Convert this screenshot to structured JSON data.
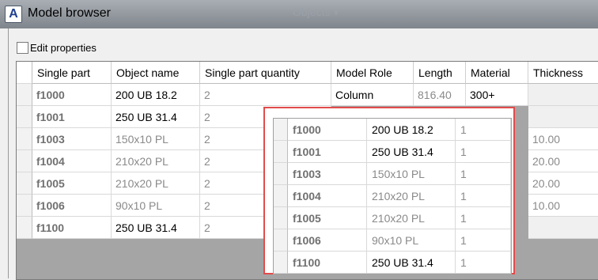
{
  "window": {
    "title": "Model browser",
    "ghost_tab": "Objects ▾"
  },
  "edit_properties_label": "Edit properties",
  "columns": [
    "Single part",
    "Object name",
    "Single part quantity",
    "Model Role",
    "Length",
    "Material",
    "Thickness"
  ],
  "rows": [
    {
      "part": "f1000",
      "name": "200 UB 18.2",
      "qty": "2",
      "role": "Column",
      "length": "816.40",
      "material": "300+",
      "thickness": ""
    },
    {
      "part": "f1001",
      "name": "250 UB 31.4",
      "qty": "2",
      "role": "",
      "length": "",
      "material": "",
      "thickness": ""
    },
    {
      "part": "f1003",
      "name": "150x10 PL",
      "qty": "2",
      "role": "",
      "length": "",
      "material": "",
      "thickness": "10.00"
    },
    {
      "part": "f1004",
      "name": "210x20 PL",
      "qty": "2",
      "role": "",
      "length": "",
      "material": "",
      "thickness": "20.00"
    },
    {
      "part": "f1005",
      "name": "210x20 PL",
      "qty": "2",
      "role": "",
      "length": "",
      "material": "",
      "thickness": "20.00"
    },
    {
      "part": "f1006",
      "name": "90x10 PL",
      "qty": "2",
      "role": "",
      "length": "",
      "material": "",
      "thickness": "10.00"
    },
    {
      "part": "f1100",
      "name": "250 UB 31.4",
      "qty": "2",
      "role": "",
      "length": "",
      "material": "",
      "thickness": ""
    }
  ],
  "popup_rows": [
    {
      "part": "f1000",
      "name": "200 UB 18.2",
      "qty": "1"
    },
    {
      "part": "f1001",
      "name": "250 UB 31.4",
      "qty": "1"
    },
    {
      "part": "f1003",
      "name": "150x10 PL",
      "qty": "1"
    },
    {
      "part": "f1004",
      "name": "210x20 PL",
      "qty": "1"
    },
    {
      "part": "f1005",
      "name": "210x20 PL",
      "qty": "1"
    },
    {
      "part": "f1006",
      "name": "90x10 PL",
      "qty": "1"
    },
    {
      "part": "f1100",
      "name": "250 UB 31.4",
      "qty": "1"
    }
  ],
  "colors": {
    "highlight_border": "#e24b4b",
    "grid_background": "#a5a5a5",
    "titlebar": "#8f959b"
  }
}
